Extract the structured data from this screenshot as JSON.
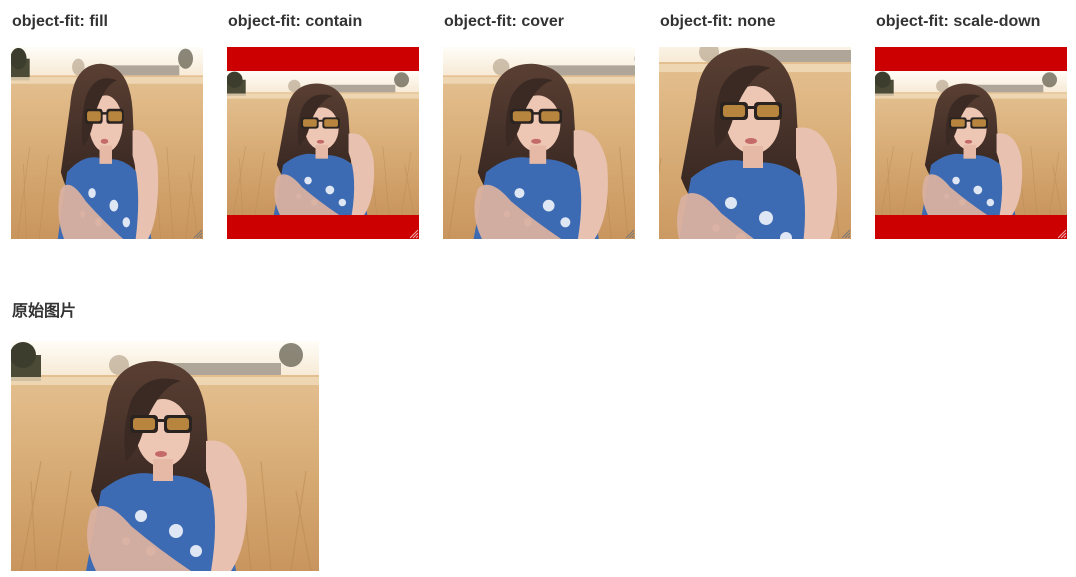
{
  "demos": [
    {
      "title": "object-fit: fill",
      "fit": "fill"
    },
    {
      "title": "object-fit: contain",
      "fit": "contain"
    },
    {
      "title": "object-fit: cover",
      "fit": "cover"
    },
    {
      "title": "object-fit: none",
      "fit": "none"
    },
    {
      "title": "object-fit: scale-down",
      "fit": "scale-down"
    }
  ],
  "original": {
    "title": "原始图片"
  },
  "colors": {
    "container_background": "#cc0000",
    "heading_text": "#333333"
  },
  "photo": {
    "subject": "woman with sunglasses in a wheat field",
    "icon": "photo-image"
  }
}
